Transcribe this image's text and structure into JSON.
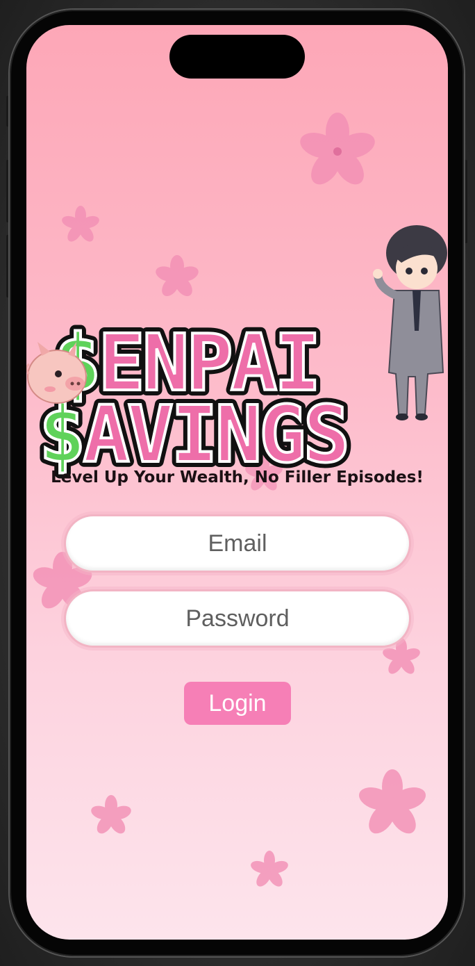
{
  "app": {
    "logo_text_line1": "$ENPAI",
    "logo_text_line2": "$AVINGS",
    "tagline": "Level Up Your Wealth, No Filler Episodes!"
  },
  "form": {
    "email_placeholder": "Email",
    "email_value": "",
    "password_placeholder": "Password",
    "password_value": "",
    "login_label": "Login"
  },
  "colors": {
    "background_top": "#fda7b7",
    "background_bottom": "#fde4ec",
    "logo_pink": "#ee6ea9",
    "logo_green": "#5fd25a",
    "login_button": "#f67fb6",
    "blossom": "#f38fb5"
  },
  "icons": {
    "piggy_bank": "piggy-bank-icon",
    "mascot": "senpai-mascot",
    "blossom": "cherry-blossom-icon"
  }
}
